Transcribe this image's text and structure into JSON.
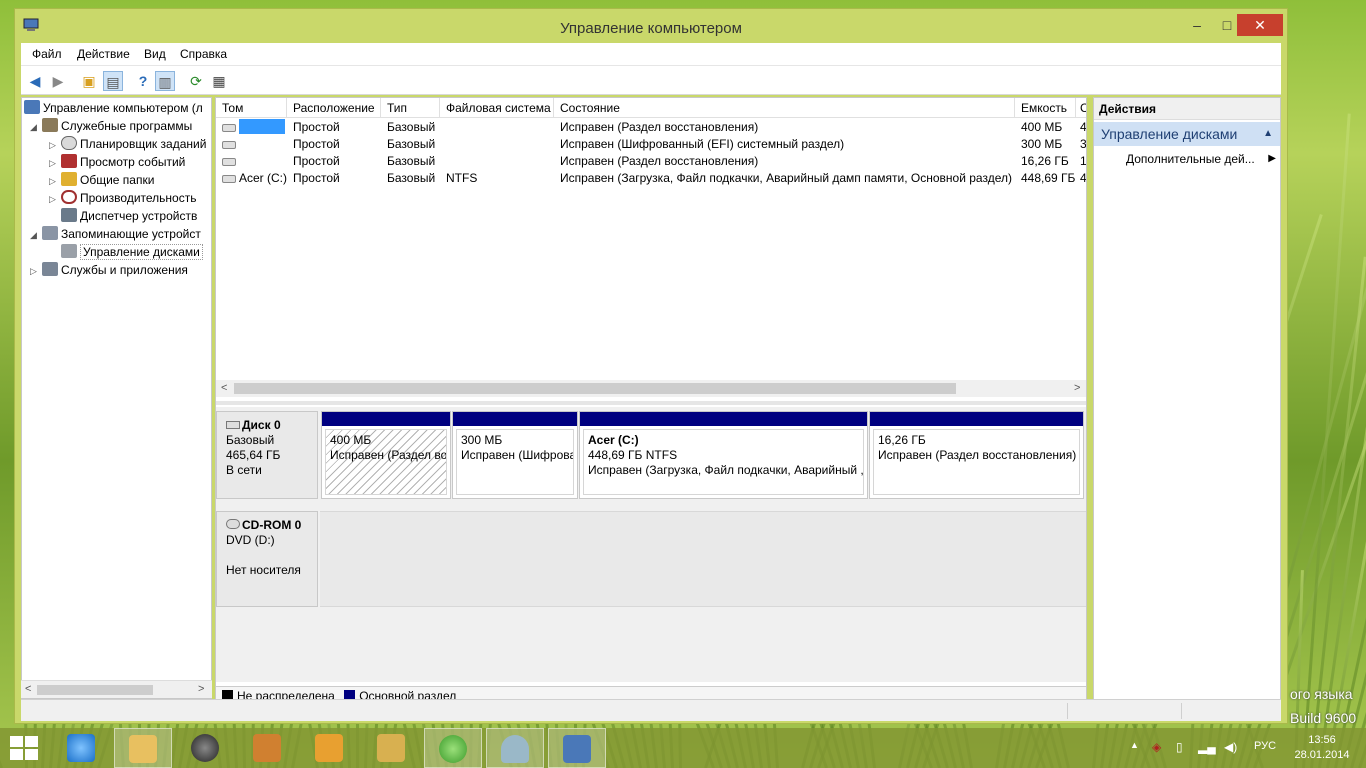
{
  "window": {
    "title": "Управление компьютером"
  },
  "menu": [
    "Файл",
    "Действие",
    "Вид",
    "Справка"
  ],
  "tree": {
    "items": [
      "Управление компьютером (л",
      "Служебные программы",
      "Планировщик заданий",
      "Просмотр событий",
      "Общие папки",
      "Производительность",
      "Диспетчер устройств",
      "Запоминающие устройст",
      "Управление дисками",
      "Службы и приложения"
    ]
  },
  "volumes": {
    "columns": [
      "Том",
      "Расположение",
      "Тип",
      "Файловая система",
      "Состояние",
      "Емкость",
      "С"
    ],
    "rows": [
      [
        "",
        "Простой",
        "Базовый",
        "",
        "Исправен (Раздел восстановления)",
        "400 МБ",
        "4"
      ],
      [
        "",
        "Простой",
        "Базовый",
        "",
        "Исправен (Шифрованный (EFI) системный раздел)",
        "300 МБ",
        "3"
      ],
      [
        "",
        "Простой",
        "Базовый",
        "",
        "Исправен (Раздел восстановления)",
        "16,26 ГБ",
        "1"
      ],
      [
        "Acer (C:)",
        "Простой",
        "Базовый",
        "NTFS",
        "Исправен (Загрузка, Файл подкачки, Аварийный дамп памяти, Основной раздел)",
        "448,69 ГБ",
        "4"
      ]
    ]
  },
  "disk0": {
    "name": "Диск 0",
    "type": "Базовый",
    "size": "465,64 ГБ",
    "status": "В сети",
    "partitions": [
      {
        "name": "",
        "size": "400 МБ",
        "status": "Исправен (Раздел вос"
      },
      {
        "name": "",
        "size": "300 МБ",
        "status": "Исправен (Шифрова"
      },
      {
        "name": "Acer  (C:)",
        "size": "448,69 ГБ NTFS",
        "status": "Исправен (Загрузка, Файл подкачки, Аварийный ,"
      },
      {
        "name": "",
        "size": "16,26 ГБ",
        "status": "Исправен (Раздел восстановления)"
      }
    ]
  },
  "cdrom": {
    "name": "CD-ROM 0",
    "drive": "DVD (D:)",
    "status": "Нет носителя"
  },
  "legend": [
    {
      "label": "Не распределена",
      "color": "#000000"
    },
    {
      "label": "Основной раздел",
      "color": "#000080"
    }
  ],
  "actions": {
    "header": "Действия",
    "section": "Управление дисками",
    "item": "Дополнительные дей..."
  },
  "desktop": {
    "line1": "ого языка",
    "line2": "Build 9600"
  },
  "taskbar": {
    "lang": "РУС",
    "time": "13:56",
    "date": "28.01.2014"
  },
  "colors": {
    "accent": "#c9d86a",
    "primary_partition": "#000080",
    "close": "#c7402d",
    "selection": "#3399ff"
  }
}
